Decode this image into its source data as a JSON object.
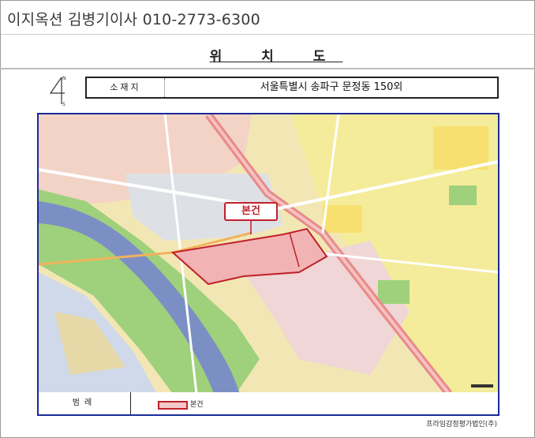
{
  "header": {
    "title": "이지옥션 김병기이사 010-2773-6300"
  },
  "document": {
    "title": "위 치 도"
  },
  "location": {
    "label": "소재지",
    "value": "서울특별시 송파구 문정동 150외"
  },
  "map": {
    "subject_label": "본건",
    "colors": {
      "subject_fill": "#f1b3b3",
      "subject_border": "#c0202a",
      "river": "#7c8fc4",
      "park": "#9fcf7a",
      "road_major": "#e88a8a",
      "land": "#f3e9b0",
      "frame": "#1a2a9a"
    }
  },
  "legend": {
    "label": "범례",
    "item_label": "본건"
  },
  "footer": {
    "firm": "프라임감정평가법인(주)"
  }
}
